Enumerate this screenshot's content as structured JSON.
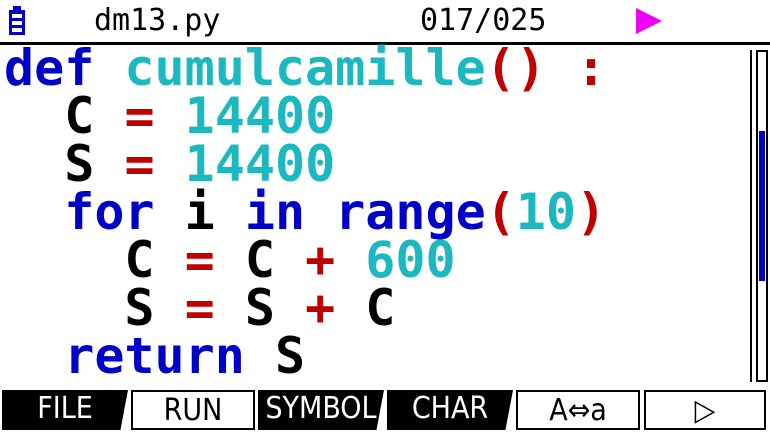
{
  "status_bar": {
    "file_name": "dm13.py",
    "line_position": "017/025",
    "battery_icon": "battery-icon",
    "run_indicator_icon": "play-triangle-icon",
    "indicator_color": "#f000f0"
  },
  "editor": {
    "lines": [
      [
        {
          "t": "def",
          "c": "kw"
        },
        {
          "t": " ",
          "c": "id"
        },
        {
          "t": "cumulcamille",
          "c": "fn"
        },
        {
          "t": "()",
          "c": "op"
        },
        {
          "t": " ",
          "c": "id"
        },
        {
          "t": ":",
          "c": "op"
        }
      ],
      [
        {
          "t": "  ",
          "c": "id"
        },
        {
          "t": "C",
          "c": "id"
        },
        {
          "t": " ",
          "c": "id"
        },
        {
          "t": "=",
          "c": "op"
        },
        {
          "t": " ",
          "c": "id"
        },
        {
          "t": "14400",
          "c": "num"
        }
      ],
      [
        {
          "t": "  ",
          "c": "id"
        },
        {
          "t": "S",
          "c": "id"
        },
        {
          "t": " ",
          "c": "id"
        },
        {
          "t": "=",
          "c": "op"
        },
        {
          "t": " ",
          "c": "id"
        },
        {
          "t": "14400",
          "c": "num"
        }
      ],
      [
        {
          "t": "  ",
          "c": "id"
        },
        {
          "t": "for",
          "c": "kw"
        },
        {
          "t": " i ",
          "c": "id"
        },
        {
          "t": "in",
          "c": "kw"
        },
        {
          "t": " ",
          "c": "id"
        },
        {
          "t": "range",
          "c": "kw"
        },
        {
          "t": "(",
          "c": "op"
        },
        {
          "t": "10",
          "c": "num"
        },
        {
          "t": ")",
          "c": "op"
        }
      ],
      [
        {
          "t": "    ",
          "c": "id"
        },
        {
          "t": "C",
          "c": "id"
        },
        {
          "t": " ",
          "c": "id"
        },
        {
          "t": "=",
          "c": "op"
        },
        {
          "t": " C ",
          "c": "id"
        },
        {
          "t": "+",
          "c": "op"
        },
        {
          "t": " ",
          "c": "id"
        },
        {
          "t": "600",
          "c": "num"
        }
      ],
      [
        {
          "t": "    ",
          "c": "id"
        },
        {
          "t": "S",
          "c": "id"
        },
        {
          "t": " ",
          "c": "id"
        },
        {
          "t": "=",
          "c": "op"
        },
        {
          "t": " S ",
          "c": "id"
        },
        {
          "t": "+",
          "c": "op"
        },
        {
          "t": " C",
          "c": "id"
        }
      ],
      [
        {
          "t": "  ",
          "c": "id"
        },
        {
          "t": "return",
          "c": "kw"
        },
        {
          "t": " S",
          "c": "id"
        }
      ]
    ],
    "colors": {
      "keyword": "#0000c8",
      "function_and_number": "#1cb8c0",
      "operator": "#c00000",
      "identifier": "#000000"
    }
  },
  "scrollbar": {
    "position_fraction": 0.4,
    "thumb_color": "#0000c8"
  },
  "function_keys": [
    {
      "label": "FILE",
      "style": "dark"
    },
    {
      "label": "RUN",
      "style": "light"
    },
    {
      "label": "SYMBOL",
      "style": "dark"
    },
    {
      "label": "CHAR",
      "style": "dark"
    },
    {
      "label": "A⇔a",
      "style": "light"
    },
    {
      "label": "▷",
      "style": "light"
    }
  ]
}
